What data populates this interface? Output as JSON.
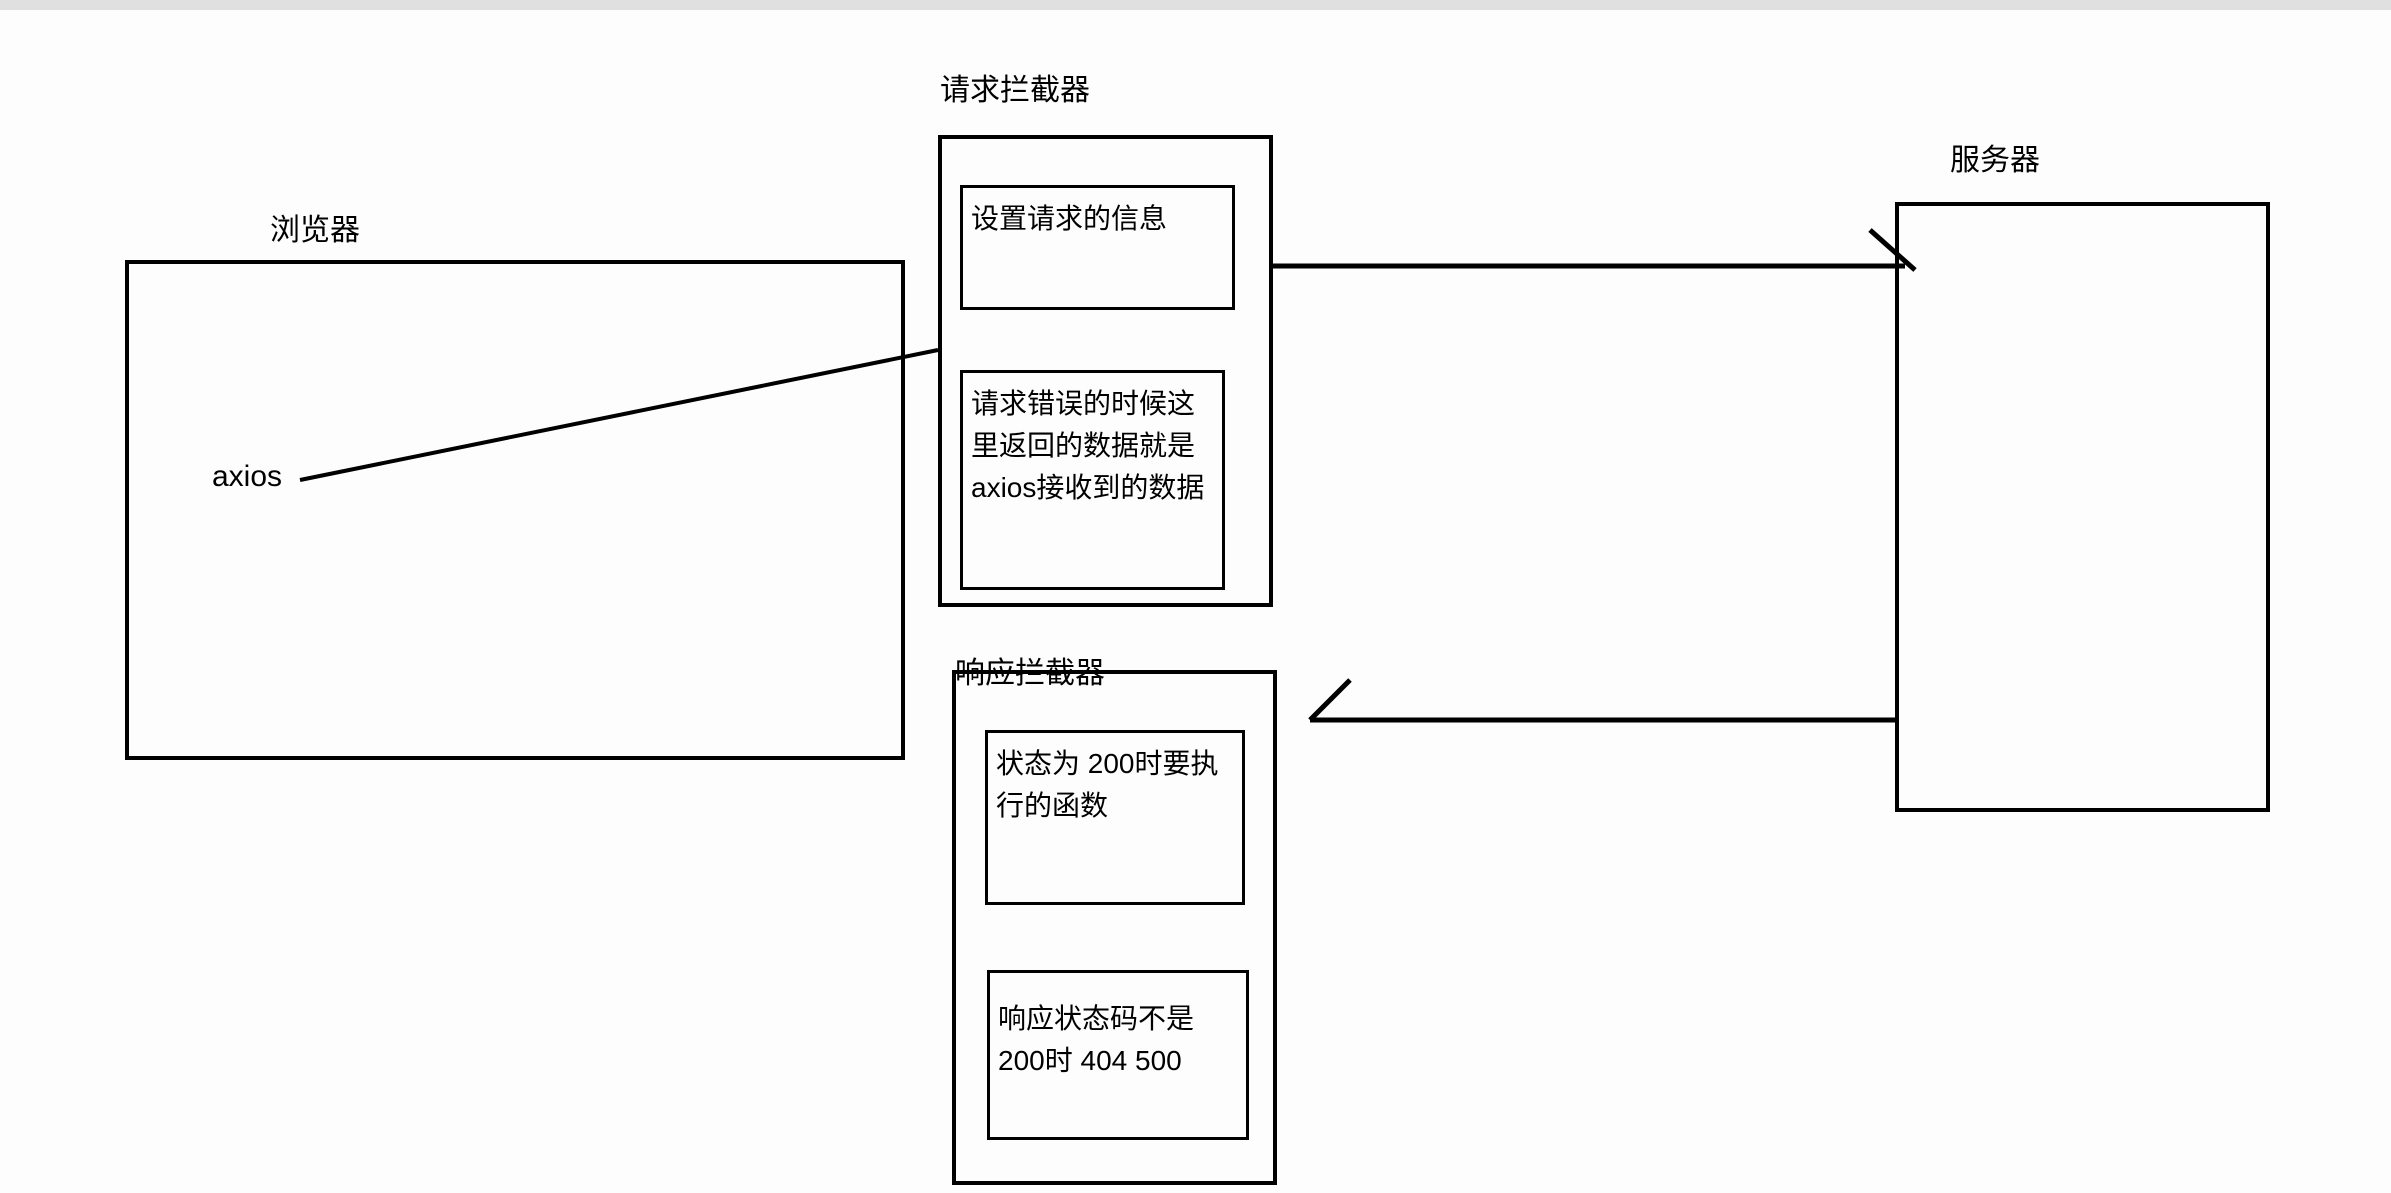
{
  "labels": {
    "browser": "浏览器",
    "request_interceptor": "请求拦截器",
    "response_interceptor": "响应拦截器",
    "server": "服务器",
    "axios": "axios"
  },
  "request_interceptor": {
    "box1": "设置请求的信息",
    "box2": "请求错误的时候这里返回的数据就是axios接收到的数据"
  },
  "response_interceptor": {
    "box1": "状态为 200时要执行的函数",
    "box2": "响应状态码不是200时  404 500"
  }
}
